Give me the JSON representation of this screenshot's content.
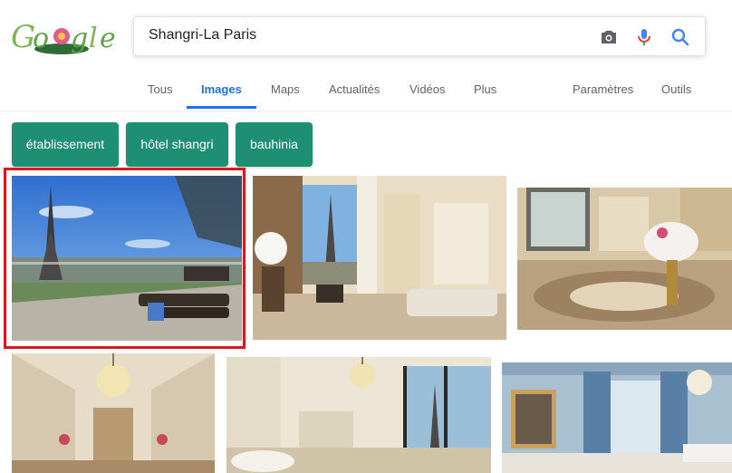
{
  "logo": {
    "text": "Google"
  },
  "search": {
    "query": "Shangri-La Paris"
  },
  "tabs": [
    {
      "label": "Tous"
    },
    {
      "label": "Images"
    },
    {
      "label": "Maps"
    },
    {
      "label": "Actualités"
    },
    {
      "label": "Vidéos"
    },
    {
      "label": "Plus"
    }
  ],
  "tools": {
    "settings": "Paramètres",
    "tools": "Outils"
  },
  "chips": [
    {
      "label": "établissement"
    },
    {
      "label": "hôtel shangri"
    },
    {
      "label": "bauhinia"
    }
  ],
  "colors": {
    "chip": "#1e8f73",
    "active_tab": "#1a73e8",
    "selection": "#d71a1f"
  },
  "icons": [
    "camera-icon",
    "microphone-icon",
    "search-icon"
  ]
}
